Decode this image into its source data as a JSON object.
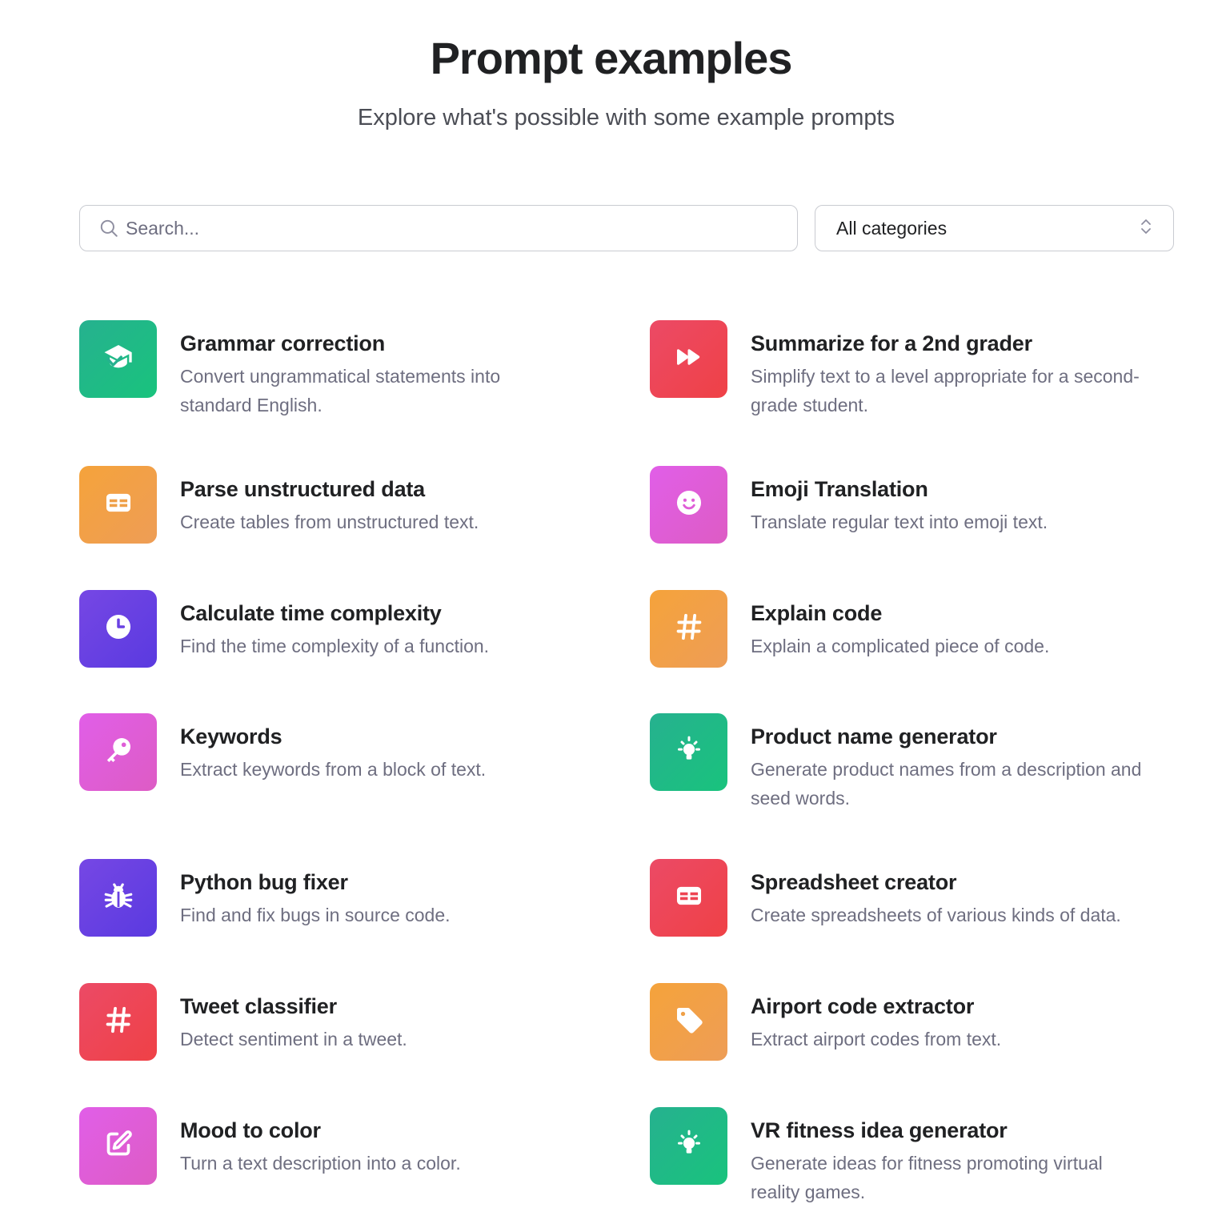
{
  "header": {
    "title": "Prompt examples",
    "subtitle": "Explore what's possible with some example prompts"
  },
  "search": {
    "placeholder": "Search...",
    "icon": "search-icon"
  },
  "category_filter": {
    "selected": "All categories",
    "icon": "chevron-up-down-icon"
  },
  "examples": [
    {
      "title": "Grammar correction",
      "description": "Convert ungrammatical statements into standard English.",
      "icon": "graduation-cap-icon",
      "color": "green"
    },
    {
      "title": "Summarize for a 2nd grader",
      "description": "Simplify text to a level appropriate for a second-grade student.",
      "icon": "fast-forward-icon",
      "color": "red"
    },
    {
      "title": "Parse unstructured data",
      "description": "Create tables from unstructured text.",
      "icon": "table-icon",
      "color": "orange"
    },
    {
      "title": "Emoji Translation",
      "description": "Translate regular text into emoji text.",
      "icon": "smiley-icon",
      "color": "pink"
    },
    {
      "title": "Calculate time complexity",
      "description": "Find the time complexity of a function.",
      "icon": "clock-icon",
      "color": "purple"
    },
    {
      "title": "Explain code",
      "description": "Explain a complicated piece of code.",
      "icon": "hashtag-icon",
      "color": "orange"
    },
    {
      "title": "Keywords",
      "description": "Extract keywords from a block of text.",
      "icon": "key-icon",
      "color": "pink"
    },
    {
      "title": "Product name generator",
      "description": "Generate product names from a description and seed words.",
      "icon": "lightbulb-icon",
      "color": "green"
    },
    {
      "title": "Python bug fixer",
      "description": "Find and fix bugs in source code.",
      "icon": "bug-icon",
      "color": "purple"
    },
    {
      "title": "Spreadsheet creator",
      "description": "Create spreadsheets of various kinds of data.",
      "icon": "table-icon",
      "color": "red"
    },
    {
      "title": "Tweet classifier",
      "description": "Detect sentiment in a tweet.",
      "icon": "hashtag-icon",
      "color": "red"
    },
    {
      "title": "Airport code extractor",
      "description": "Extract airport codes from text.",
      "icon": "tag-icon",
      "color": "orange"
    },
    {
      "title": "Mood to color",
      "description": "Turn a text description into a color.",
      "icon": "edit-icon",
      "color": "pink"
    },
    {
      "title": "VR fitness idea generator",
      "description": "Generate ideas for fitness promoting virtual reality games.",
      "icon": "lightbulb-icon",
      "color": "green"
    }
  ],
  "colors": {
    "green": "#19c37d",
    "red": "#ef4146",
    "orange": "#f4a23e",
    "pink": "#e15ee8",
    "purple": "#6b41e3",
    "text_primary": "#202123",
    "text_secondary": "#6e6e80"
  }
}
